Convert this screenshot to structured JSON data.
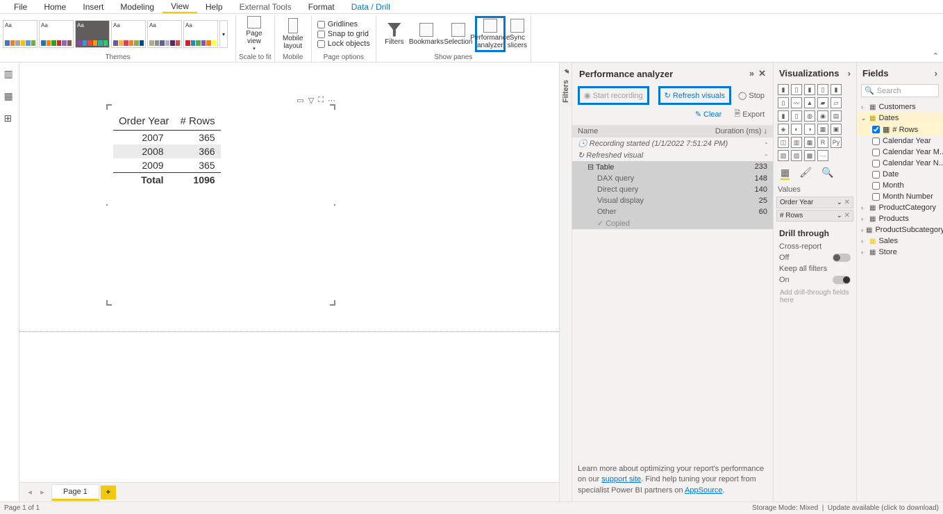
{
  "menubar": {
    "file": "File",
    "home": "Home",
    "insert": "Insert",
    "modeling": "Modeling",
    "view": "View",
    "help": "Help",
    "external_tools": "External Tools",
    "format": "Format",
    "data_drill": "Data / Drill"
  },
  "ribbon": {
    "themes_label": "Themes",
    "scale_label": "Scale to fit",
    "mobile_label": "Mobile",
    "page_options_label": "Page options",
    "show_panes_label": "Show panes",
    "page_view": "Page view",
    "mobile_layout": "Mobile layout",
    "gridlines": "Gridlines",
    "snap_to_grid": "Snap to grid",
    "lock_objects": "Lock objects",
    "filters": "Filters",
    "bookmarks": "Bookmarks",
    "selection": "Selection",
    "perf_analyzer": "Performance analyzer",
    "sync_slicers": "Sync slicers"
  },
  "canvas": {
    "table_headers": {
      "col1": "Order Year",
      "col2": "# Rows"
    },
    "rows": [
      {
        "year": "2007",
        "count": "365"
      },
      {
        "year": "2008",
        "count": "366"
      },
      {
        "year": "2009",
        "count": "365"
      }
    ],
    "total_label": "Total",
    "total_value": "1096"
  },
  "pages": {
    "page1": "Page 1"
  },
  "filters_label": "Filters",
  "perf": {
    "title": "Performance analyzer",
    "start_recording": "Start recording",
    "refresh_visuals": "Refresh visuals",
    "stop": "Stop",
    "clear": "Clear",
    "export": "Export",
    "col_name": "Name",
    "col_duration": "Duration (ms)",
    "rec_started": "Recording started (1/1/2022 7:51:24 PM)",
    "refreshed": "Refreshed visual",
    "table_row": "Table",
    "table_ms": "233",
    "dax_query": "DAX query",
    "dax_ms": "148",
    "direct_query": "Direct query",
    "direct_ms": "140",
    "visual_display": "Visual display",
    "visual_ms": "25",
    "other": "Other",
    "other_ms": "60",
    "copied": "Copied",
    "footer1": "Learn more about optimizing your report's performance on our ",
    "footer_link1": "support site",
    "footer2": ". Find help tuning your report from specialist Power BI partners on ",
    "footer_link2": "AppSource",
    "footer3": "."
  },
  "viz": {
    "title": "Visualizations",
    "values": "Values",
    "field1": "Order Year",
    "field2": "# Rows",
    "drill_through": "Drill through",
    "cross_report": "Cross-report",
    "off": "Off",
    "keep_filters": "Keep all filters",
    "on": "On",
    "add_drill": "Add drill-through fields here"
  },
  "fields": {
    "title": "Fields",
    "search_placeholder": "Search",
    "customers": "Customers",
    "dates": "Dates",
    "rows": "# Rows",
    "calendar_year": "Calendar Year",
    "calendar_year_m": "Calendar Year M...",
    "calendar_year_n": "Calendar Year N...",
    "date": "Date",
    "month": "Month",
    "month_number": "Month Number",
    "product_category": "ProductCategory",
    "products": "Products",
    "product_subcategory": "ProductSubcategory",
    "sales": "Sales",
    "store": "Store"
  },
  "statusbar": {
    "page": "Page 1 of 1",
    "storage": "Storage Mode: Mixed",
    "update": "Update available (click to download)"
  }
}
